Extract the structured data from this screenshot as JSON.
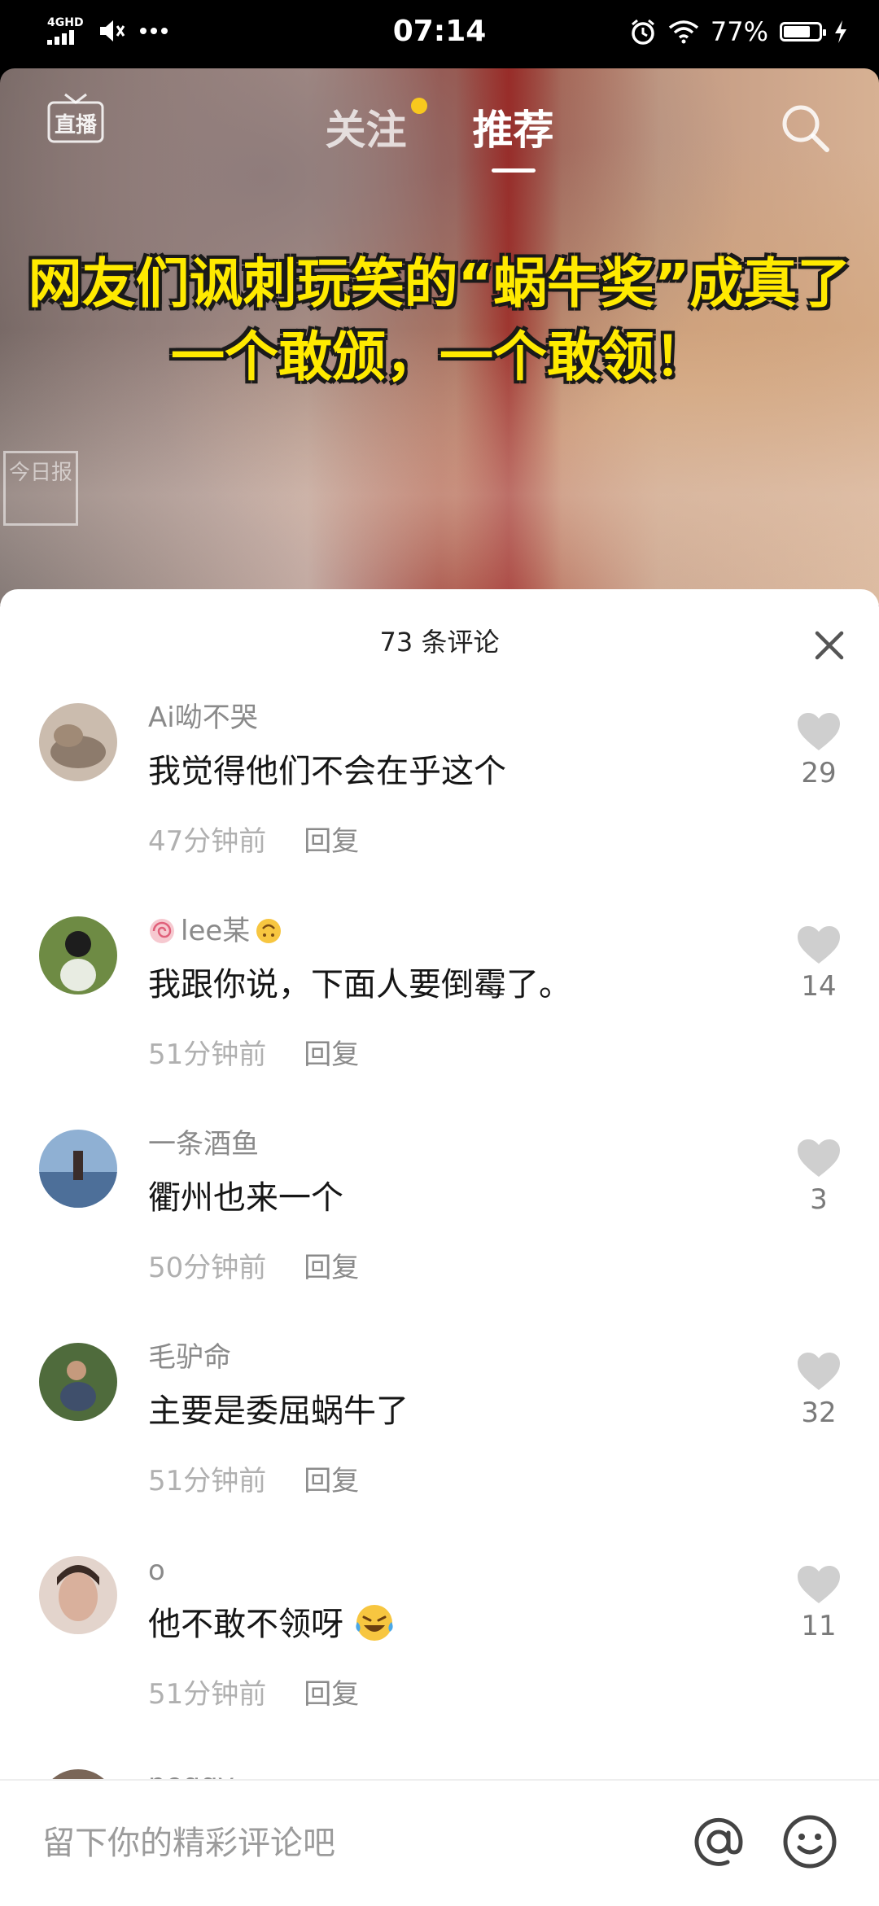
{
  "status_bar": {
    "network": "4GHD",
    "time": "07:14",
    "battery_percent": "77%"
  },
  "top_nav": {
    "live_label": "直播",
    "tabs": [
      {
        "label": "关注",
        "active": false,
        "has_dot": true
      },
      {
        "label": "推荐",
        "active": true
      }
    ]
  },
  "video": {
    "caption_line1": "网友们讽刺玩笑的“蜗牛奖”成真了",
    "caption_line2": "一个敢颁，一个敢领！",
    "watermark": "今日报"
  },
  "comments_panel": {
    "title": "73 条评论",
    "reply_label": "回复",
    "comments": [
      {
        "name": "Ai呦不哭",
        "text": "我觉得他们不会在乎这个",
        "time": "47分钟前",
        "likes": "29",
        "avatar_color": "#b8a898"
      },
      {
        "name": "lee某",
        "text": "我跟你说，下面人要倒霉了。",
        "time": "51分钟前",
        "likes": "14",
        "avatar_color": "#5c7a3a"
      },
      {
        "name": "一条酒鱼",
        "text": "衢州也来一个",
        "time": "50分钟前",
        "likes": "3",
        "avatar_color": "#6a8fb8"
      },
      {
        "name": "毛驴命",
        "text": "主要是委屈蜗牛了",
        "time": "51分钟前",
        "likes": "32",
        "avatar_color": "#4f6b3c"
      },
      {
        "name": "o",
        "text": "他不敢不领呀",
        "time": "51分钟前",
        "likes": "11",
        "avatar_color": "#c9a89a"
      },
      {
        "name": "peggy",
        "text": "",
        "time": "",
        "likes": "",
        "avatar_color": "#7a6658"
      }
    ]
  },
  "input_bar": {
    "placeholder": "留下你的精彩评论吧"
  }
}
